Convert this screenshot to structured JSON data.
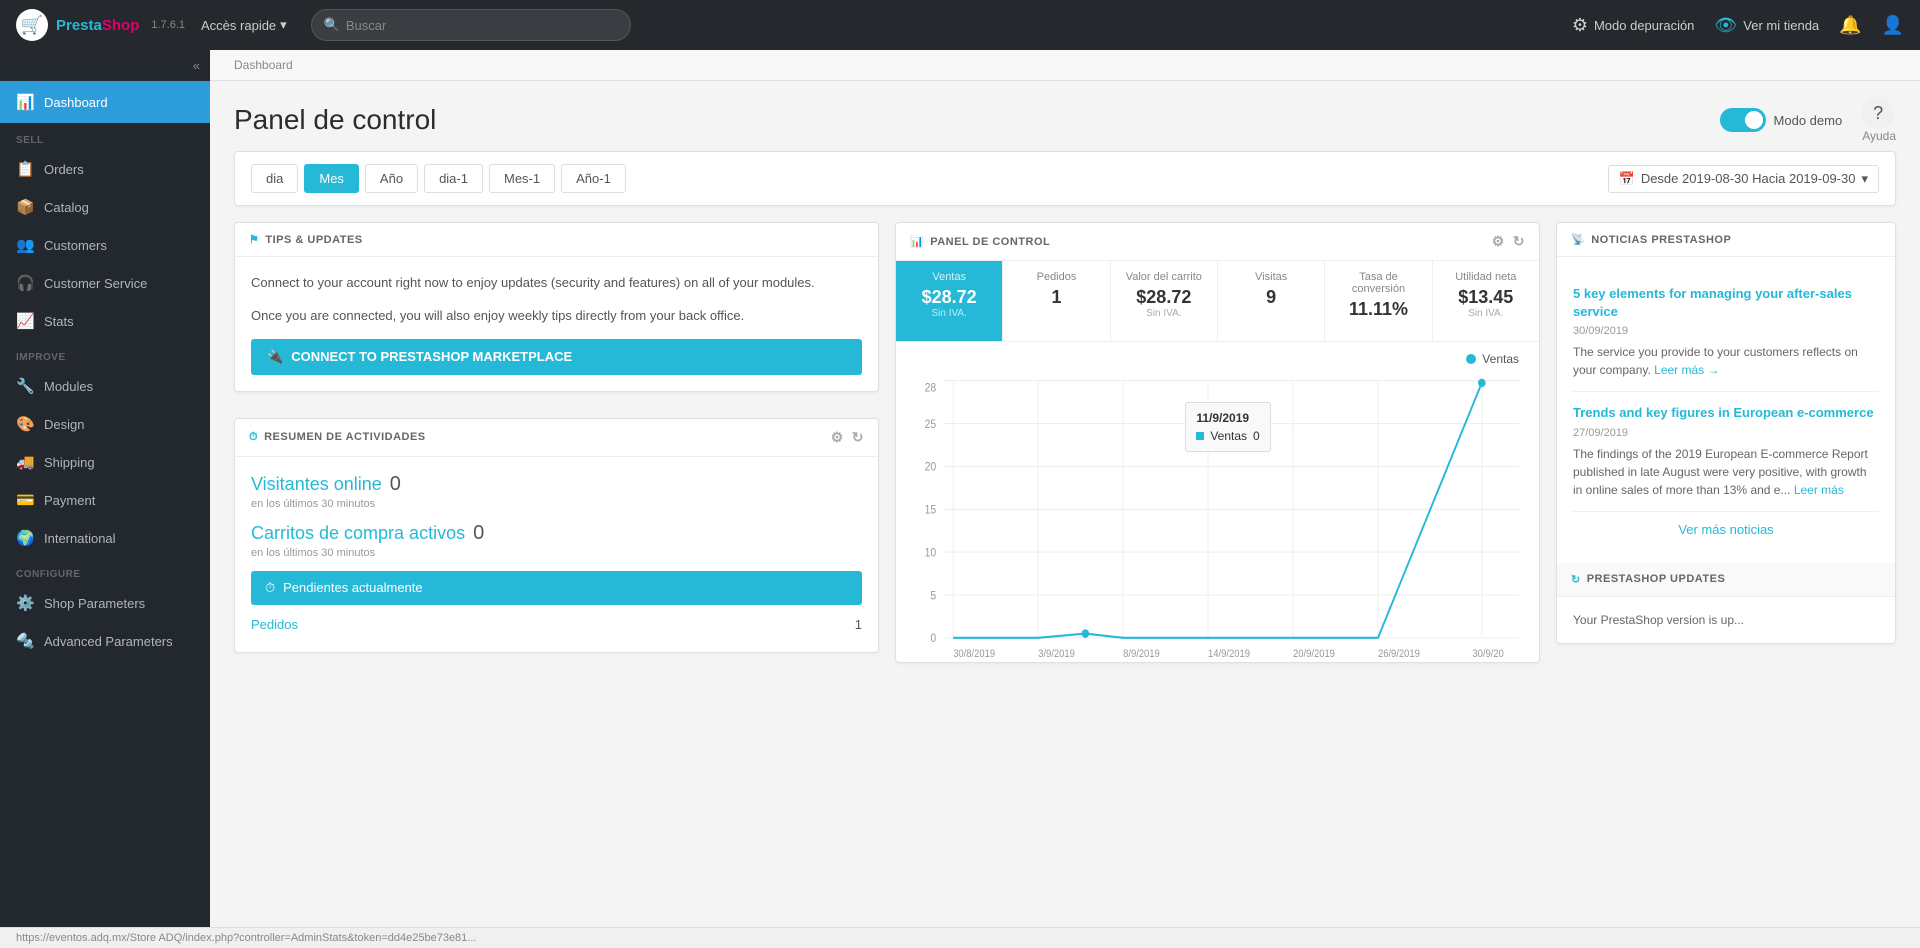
{
  "app": {
    "name_part1": "Presta",
    "name_part2": "Shop",
    "version": "1.7.6.1"
  },
  "topnav": {
    "quick_access_label": "Accès rapide",
    "search_placeholder": "Buscar",
    "debug_mode_label": "Modo depuración",
    "view_store_label": "Ver mi tienda"
  },
  "sidebar": {
    "collapse_label": "«",
    "dashboard_label": "Dashboard",
    "sell_section": "SELL",
    "orders_label": "Orders",
    "catalog_label": "Catalog",
    "customers_label": "Customers",
    "customer_service_label": "Customer Service",
    "stats_label": "Stats",
    "improve_section": "IMPROVE",
    "modules_label": "Modules",
    "design_label": "Design",
    "shipping_label": "Shipping",
    "payment_label": "Payment",
    "international_label": "International",
    "configure_section": "CONFIGURE",
    "shop_parameters_label": "Shop Parameters",
    "advanced_parameters_label": "Advanced Parameters"
  },
  "breadcrumb": "Dashboard",
  "page_title": "Panel de control",
  "header_actions": {
    "modo_demo_label": "Modo demo",
    "ayuda_label": "Ayuda"
  },
  "tabs": {
    "items": [
      "dia",
      "Mes",
      "Año",
      "dia-1",
      "Mes-1",
      "Año-1"
    ],
    "active": "Mes",
    "date_range": "Desde 2019-08-30 Hacia 2019-09-30"
  },
  "tips_card": {
    "header": "TIPS & UPDATES",
    "text1": "Connect to your account right now to enjoy updates (security and features) on all of your modules.",
    "text2": "Once you are connected, you will also enjoy weekly tips directly from your back office.",
    "button_label": "CONNECT TO PRESTASHOP MARKETPLACE"
  },
  "activities_card": {
    "header": "RESUMEN DE ACTIVIDADES",
    "online_visitors_label": "Visitantes online",
    "online_visitors_count": "0",
    "online_visitors_sub": "en los últimos 30 minutos",
    "carts_label": "Carritos de compra activos",
    "carts_count": "0",
    "carts_sub": "en los últimos 30 minutos",
    "pending_btn_label": "Pendientes actualmente",
    "orders_label": "Pedidos",
    "orders_count": "1"
  },
  "panel_control": {
    "header": "PANEL DE CONTROL",
    "metrics": [
      {
        "label": "Ventas",
        "value": "$28.72",
        "sub": "Sin IVA.",
        "active": true
      },
      {
        "label": "Pedidos",
        "value": "1",
        "sub": "",
        "active": false
      },
      {
        "label": "Valor del carrito",
        "value": "$28.72",
        "sub": "Sin IVA.",
        "active": false
      },
      {
        "label": "Visitas",
        "value": "9",
        "sub": "",
        "active": false
      },
      {
        "label": "Tasa de conversión",
        "value": "11.11%",
        "sub": "",
        "active": false
      },
      {
        "label": "Utilidad neta",
        "value": "$13.45",
        "sub": "Sin IVA.",
        "active": false
      }
    ],
    "chart": {
      "x_labels": [
        "30/8/2019",
        "3/9/2019",
        "8/9/2019",
        "14/9/2019",
        "20/9/2019",
        "26/9/2019",
        "30/9/20"
      ],
      "y_labels": [
        "0",
        "5",
        "10",
        "15",
        "20",
        "25",
        "28"
      ],
      "legend_label": "Ventas",
      "tooltip_date": "11/9/2019",
      "tooltip_label": "Ventas",
      "tooltip_value": "0"
    }
  },
  "noticias": {
    "header": "NOTICIAS PRESTASHOP",
    "items": [
      {
        "title": "5 key elements for managing your after-sales service",
        "date": "30/09/2019",
        "text": "The service you provide to your customers reflects on your company.",
        "readmore": "Leer más →"
      },
      {
        "title": "Trends and key figures in European e-commerce",
        "date": "27/09/2019",
        "text": "The findings of the 2019 European E-commerce Report published in late August were very positive, with growth in online sales of more than 13% and e...",
        "readmore": "Leer más"
      }
    ],
    "more_news_label": "Ver más noticias",
    "updates_header": "PRESTASHOP UPDATES",
    "updates_text": "Your PrestaShop version is up..."
  },
  "statusbar": {
    "url": "https://eventos.adq.mx/Store ADQ/index.php?controller=AdminStats&token=dd4e25be73e81..."
  }
}
